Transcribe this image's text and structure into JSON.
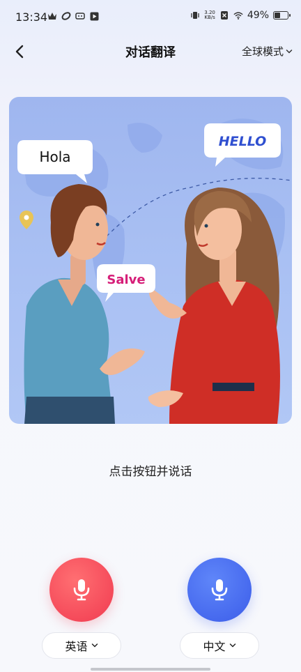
{
  "status_bar": {
    "time": "13:34",
    "net_speed_value": "3.20",
    "net_speed_unit": "KB/s",
    "battery_percent": "49%",
    "battery_level": 0.49
  },
  "nav": {
    "title": "对话翻译",
    "mode_label": "全球模式"
  },
  "illustration": {
    "bubble_left": "Hola",
    "bubble_right": "HELLO",
    "bubble_middle": "Salve"
  },
  "prompt": "点击按钮并说话",
  "languages": {
    "left": "英语",
    "right": "中文"
  },
  "colors": {
    "mic_left": "#f54a5a",
    "mic_right": "#4669ee",
    "hello_text": "#2f4fd0",
    "salve_text": "#d61e78"
  }
}
